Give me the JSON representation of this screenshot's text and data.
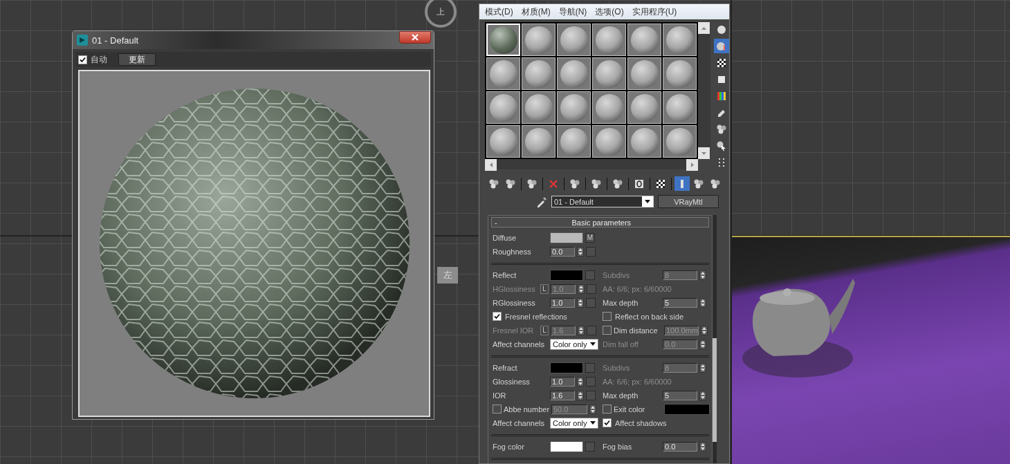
{
  "viewport_labels": [
    {
      "kind": "viewcube",
      "text": "上"
    },
    {
      "kind": "tag",
      "text": "左"
    }
  ],
  "preview_window": {
    "title": "01 - Default",
    "auto": {
      "label": "自动",
      "checked": true
    },
    "update_button": "更新"
  },
  "material_editor": {
    "menu": [
      "模式(D)",
      "材质(M)",
      "导航(N)",
      "选项(O)",
      "实用程序(U)"
    ],
    "slots": [
      {
        "kind": "textured",
        "selected": true
      },
      {
        "kind": "plain",
        "selected": false
      },
      {
        "kind": "plain",
        "selected": false
      },
      {
        "kind": "plain",
        "selected": false
      },
      {
        "kind": "plain",
        "selected": false
      },
      {
        "kind": "plain",
        "selected": false
      },
      {
        "kind": "plain",
        "selected": false
      },
      {
        "kind": "plain",
        "selected": false
      },
      {
        "kind": "plain",
        "selected": false
      },
      {
        "kind": "plain",
        "selected": false
      },
      {
        "kind": "plain",
        "selected": false
      },
      {
        "kind": "plain",
        "selected": false
      },
      {
        "kind": "plain",
        "selected": false
      },
      {
        "kind": "plain",
        "selected": false
      },
      {
        "kind": "plain",
        "selected": false
      },
      {
        "kind": "plain",
        "selected": false
      },
      {
        "kind": "plain",
        "selected": false
      },
      {
        "kind": "plain",
        "selected": false
      },
      {
        "kind": "plain",
        "selected": false
      },
      {
        "kind": "plain",
        "selected": false
      },
      {
        "kind": "plain",
        "selected": false
      },
      {
        "kind": "plain",
        "selected": false
      },
      {
        "kind": "plain",
        "selected": false
      },
      {
        "kind": "plain",
        "selected": false
      }
    ],
    "side_tools": [
      {
        "selected": false
      },
      {
        "selected": true
      },
      {
        "selected": false
      },
      {
        "selected": false
      },
      {
        "selected": false
      },
      {
        "selected": false
      },
      {
        "selected": false
      },
      {
        "selected": false
      },
      {
        "selected": false
      }
    ],
    "toolbar": [
      {
        "selected": false
      },
      {
        "selected": false
      },
      {
        "selected": false
      },
      {
        "selected": false
      },
      {
        "selected": false
      },
      {
        "selected": false
      },
      {
        "selected": false
      },
      {
        "selected": false
      },
      {
        "selected": false
      },
      {
        "selected": true
      },
      {
        "selected": false
      },
      {
        "selected": false
      }
    ],
    "material_name": "01 - Default",
    "material_type": "VRayMtl",
    "rollout": {
      "title": "Basic parameters",
      "toggle": "-",
      "sections": [
        [
          {
            "left": {
              "kind": "color",
              "label": "Diffuse",
              "color": "#b9b9b9",
              "map": "M",
              "disabled": false
            }
          },
          {
            "left": {
              "kind": "spinner",
              "label": "Roughness",
              "value": "0.0",
              "map_slot": true,
              "disabled": false
            }
          }
        ],
        [
          {
            "left": {
              "kind": "color",
              "label": "Reflect",
              "color": "#000000",
              "disabled": false
            },
            "right": {
              "kind": "spinner",
              "label": "Subdivs",
              "value": "8",
              "map_slot": false,
              "disabled": true
            }
          },
          {
            "left": {
              "kind": "spinner",
              "label": "HGlossiness",
              "lock": "L",
              "value": "1.0",
              "map_slot": true,
              "disabled": true
            },
            "right": {
              "kind": "info",
              "text": "AA: 6/6; px: 6/60000",
              "disabled": true
            }
          },
          {
            "left": {
              "kind": "spinner",
              "label": "RGlossiness",
              "value": "1.0",
              "map_slot": true,
              "disabled": false
            },
            "right": {
              "kind": "spinner",
              "label": "Max depth",
              "value": "5",
              "map_slot": false,
              "disabled": false
            }
          },
          {
            "left": {
              "kind": "check",
              "label": "Fresnel reflections",
              "checked": true,
              "disabled": false
            },
            "right": {
              "kind": "check",
              "label": "Reflect on back side",
              "checked": false,
              "disabled": false
            }
          },
          {
            "left": {
              "kind": "spinner",
              "label": "Fresnel IOR",
              "lock": "L",
              "value": "1.6",
              "map_slot": true,
              "disabled": true
            },
            "right": {
              "kind": "check_spinner",
              "label": "Dim distance",
              "checked": false,
              "value": "100.0mm",
              "disabled": true
            }
          },
          {
            "left": {
              "kind": "dropdown",
              "label": "Affect channels",
              "value": "Color only",
              "disabled": false
            },
            "right": {
              "kind": "spinner",
              "label": "Dim fall off",
              "value": "0.0",
              "map_slot": false,
              "disabled": true
            }
          }
        ],
        [
          {
            "left": {
              "kind": "color",
              "label": "Refract",
              "color": "#000000",
              "disabled": false
            },
            "right": {
              "kind": "spinner",
              "label": "Subdivs",
              "value": "8",
              "map_slot": false,
              "disabled": true
            }
          },
          {
            "left": {
              "kind": "spinner",
              "label": "Glossiness",
              "value": "1.0",
              "map_slot": true,
              "disabled": false
            },
            "right": {
              "kind": "info",
              "text": "AA: 6/6; px: 6/60000",
              "disabled": true
            }
          },
          {
            "left": {
              "kind": "spinner",
              "label": "IOR",
              "value": "1.6",
              "map_slot": true,
              "disabled": false
            },
            "right": {
              "kind": "spinner",
              "label": "Max depth",
              "value": "5",
              "map_slot": false,
              "disabled": false
            }
          },
          {
            "left": {
              "kind": "check_spinner",
              "label": "Abbe number",
              "checked": false,
              "value": "50.0",
              "disabled": true
            },
            "right": {
              "kind": "check_color",
              "label": "Exit color",
              "checked": false,
              "color": "#000000",
              "disabled": false
            }
          },
          {
            "left": {
              "kind": "dropdown",
              "label": "Affect channels",
              "value": "Color only",
              "disabled": false
            },
            "right": {
              "kind": "check",
              "label": "Affect shadows",
              "checked": true,
              "disabled": false
            }
          }
        ],
        [
          {
            "left": {
              "kind": "color",
              "label": "Fog color",
              "color": "#ffffff",
              "disabled": false
            },
            "right": {
              "kind": "spinner",
              "label": "Fog bias",
              "value": "0.0",
              "map_slot": false,
              "disabled": false
            }
          }
        ]
      ]
    }
  }
}
